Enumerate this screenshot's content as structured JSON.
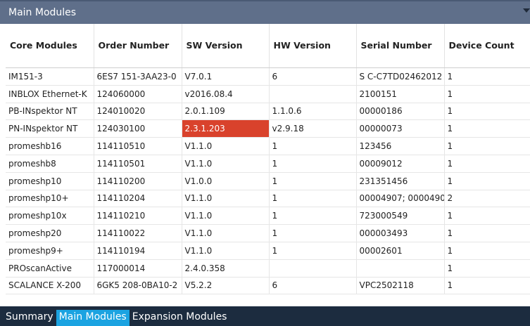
{
  "header": {
    "title": "Main Modules"
  },
  "table": {
    "columns": [
      "Core Modules",
      "Order Number",
      "SW Version",
      "HW Version",
      "Serial Number",
      "Device Count"
    ],
    "rows": [
      [
        "IM151-3",
        "6ES7 151-3AA23-0",
        "V7.0.1",
        "6",
        "S C-C7TD02462012",
        "1"
      ],
      [
        "INBLOX Ethernet-K",
        "124060000",
        "v2016.08.4",
        "",
        "2100151",
        "1"
      ],
      [
        "PB-INspektor NT",
        "124010020",
        "2.0.1.109",
        "1.1.0.6",
        "00000186",
        "1"
      ],
      [
        "PN-INspektor NT",
        "124030100",
        "2.3.1.203",
        "v2.9.18",
        "00000073",
        "1"
      ],
      [
        "promeshb16",
        "114110510",
        "V1.1.0",
        "1",
        "123456",
        "1"
      ],
      [
        "promeshb8",
        "114110501",
        "V1.1.0",
        "1",
        "00009012",
        "1"
      ],
      [
        "promeshp10",
        "114110200",
        "V1.0.0",
        "1",
        "231351456",
        "1"
      ],
      [
        "promeshp10+",
        "114110204",
        "V1.1.0",
        "1",
        "00004907; 0000490",
        "2"
      ],
      [
        "promeshp10x",
        "114110210",
        "V1.1.0",
        "1",
        "723000549",
        "1"
      ],
      [
        "promeshp20",
        "114110022",
        "V1.1.0",
        "1",
        "000003493",
        "1"
      ],
      [
        "promeshp9+",
        "114110194",
        "V1.1.0",
        "1",
        "00002601",
        "1"
      ],
      [
        "PROscanActive",
        "117000014",
        "2.4.0.358",
        "",
        "",
        "1"
      ],
      [
        "SCALANCE X-200",
        "6GK5 208-0BA10-2",
        "V5.2.2",
        "6",
        "VPC2502118",
        "1"
      ]
    ],
    "highlight": {
      "row": 3,
      "col": 2,
      "color": "#d9422c"
    }
  },
  "tabs": [
    {
      "label": "Summary",
      "active": false
    },
    {
      "label": "Main Modules",
      "active": true
    },
    {
      "label": "Expansion Modules",
      "active": false
    }
  ]
}
